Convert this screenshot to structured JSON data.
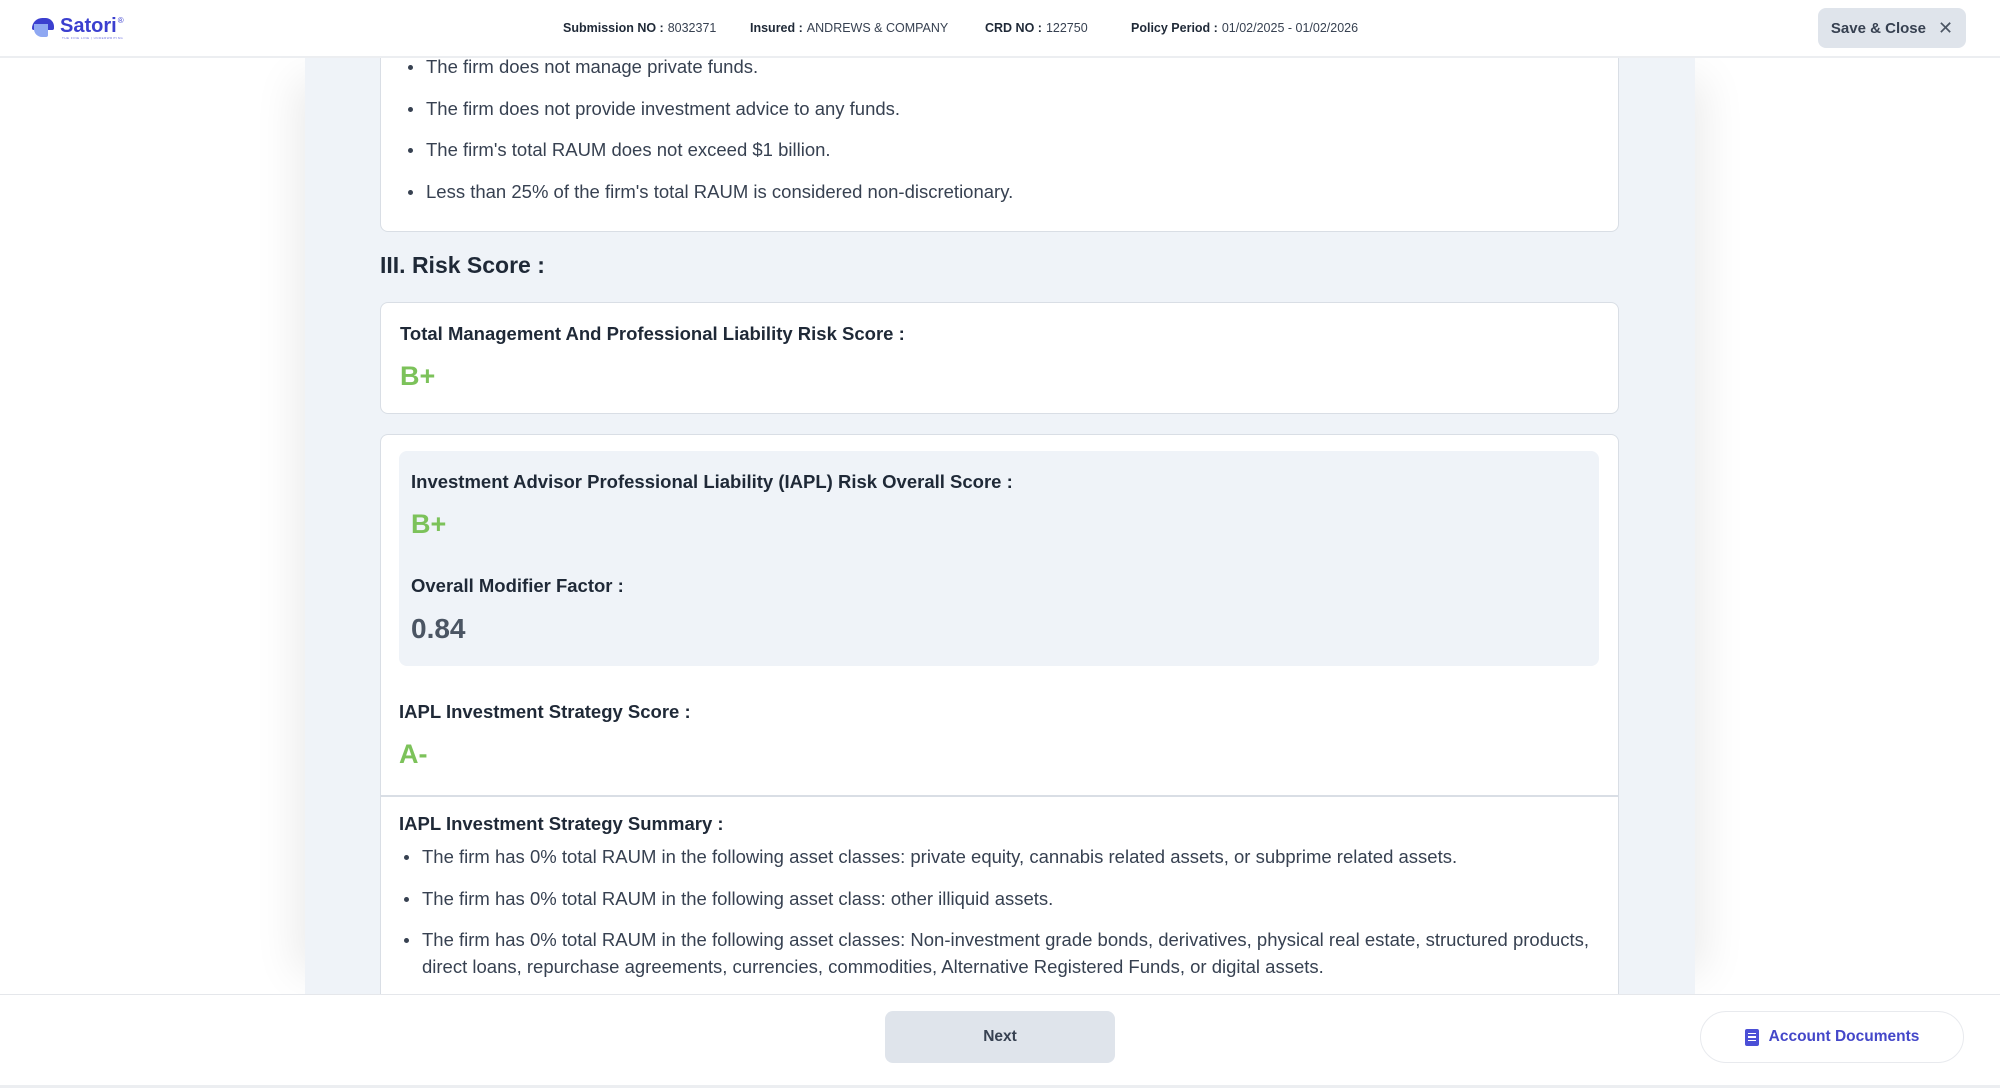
{
  "header": {
    "brand": "Satori",
    "brand_mark": "®",
    "brand_tagline": "THE FINE LINE | UNDERWRITING",
    "submission": {
      "label": "Submission NO :",
      "value": "8032371"
    },
    "insured": {
      "label": "Insured :",
      "value": "ANDREWS & COMPANY"
    },
    "crd": {
      "label": "CRD NO :",
      "value": "122750"
    },
    "policy_period": {
      "label": "Policy Period :",
      "value": "01/02/2025 - 01/02/2026"
    },
    "save_close_label": "Save & Close",
    "close_icon": "close-icon"
  },
  "main": {
    "top_bullets": [
      "The firm does not manage private funds.",
      "The firm does not provide investment advice to any funds.",
      "The firm's total RAUM does not exceed $1 billion.",
      "Less than 25% of the firm's total RAUM is considered non-discretionary."
    ],
    "section_title": "III. Risk Score :",
    "total_score": {
      "label": "Total Management And Professional Liability Risk Score :",
      "grade": "B+"
    },
    "iapl": {
      "overall_label": "Investment Advisor Professional Liability (IAPL) Risk Overall Score :",
      "overall_grade": "B+",
      "modifier_label": "Overall Modifier Factor :",
      "modifier_value": "0.84",
      "strategy_label": "IAPL Investment Strategy Score :",
      "strategy_grade": "A-",
      "summary_label": "IAPL Investment Strategy Summary :",
      "summary_bullets": [
        "The firm has 0% total RAUM in the following asset classes: private equity, cannabis related assets, or subprime related assets.",
        "The firm has 0% total RAUM in the following asset class: other illiquid assets.",
        "The firm has 0% total RAUM in the following asset classes: Non-investment grade bonds, derivatives, physical real estate, structured products, direct loans, repurchase agreements, currencies, commodities, Alternative Registered Funds, or digital assets."
      ]
    },
    "colors": {
      "grade": "#7cc25a",
      "brand": "#3b3fcf"
    }
  },
  "footer": {
    "next_label": "Next",
    "account_documents_label": "Account Documents",
    "documents_icon": "document-icon"
  }
}
